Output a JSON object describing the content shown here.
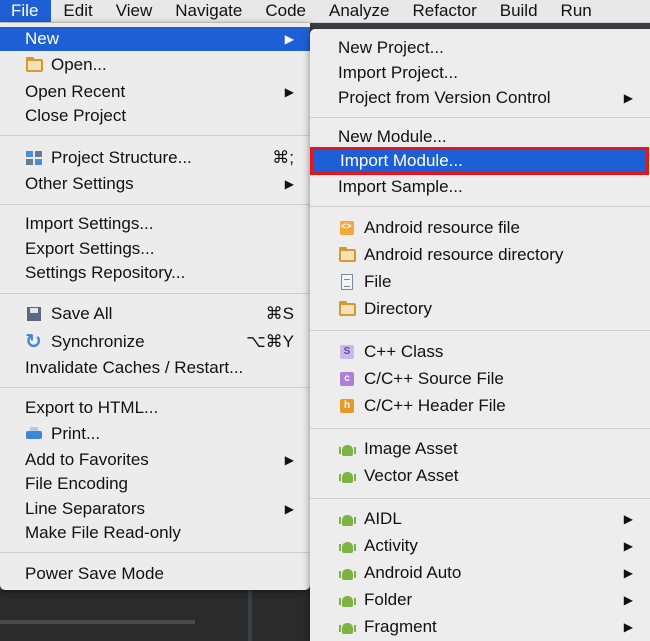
{
  "menubar": [
    "File",
    "Edit",
    "View",
    "Navigate",
    "Code",
    "Analyze",
    "Refactor",
    "Build",
    "Run"
  ],
  "file_menu": {
    "new": "New",
    "open": "Open...",
    "open_recent": "Open Recent",
    "close_project": "Close Project",
    "project_structure": "Project Structure...",
    "project_structure_shortcut": "⌘;",
    "other_settings": "Other Settings",
    "import_settings": "Import Settings...",
    "export_settings": "Export Settings...",
    "settings_repository": "Settings Repository...",
    "save_all": "Save All",
    "save_all_shortcut": "⌘S",
    "synchronize": "Synchronize",
    "synchronize_shortcut": "⌥⌘Y",
    "invalidate_caches": "Invalidate Caches / Restart...",
    "export_html": "Export to HTML...",
    "print": "Print...",
    "add_favorites": "Add to Favorites",
    "file_encoding": "File Encoding",
    "line_separators": "Line Separators",
    "make_read_only": "Make File Read-only",
    "power_save": "Power Save Mode"
  },
  "new_menu": {
    "new_project": "New Project...",
    "import_project": "Import Project...",
    "project_vcs": "Project from Version Control",
    "new_module": "New Module...",
    "import_module": "Import Module...",
    "import_sample": "Import Sample...",
    "android_resource_file": "Android resource file",
    "android_resource_directory": "Android resource directory",
    "file": "File",
    "directory": "Directory",
    "cpp_class": "C++ Class",
    "cpp_source": "C/C++ Source File",
    "cpp_header": "C/C++ Header File",
    "image_asset": "Image Asset",
    "vector_asset": "Vector Asset",
    "aidl": "AIDL",
    "activity": "Activity",
    "android_auto": "Android Auto",
    "folder": "Folder",
    "fragment": "Fragment"
  },
  "submenu_arrow": "▶",
  "colors": {
    "highlight": "#1f5fd6",
    "annotation_box": "#e8141c",
    "menu_bg": "#ececec"
  }
}
